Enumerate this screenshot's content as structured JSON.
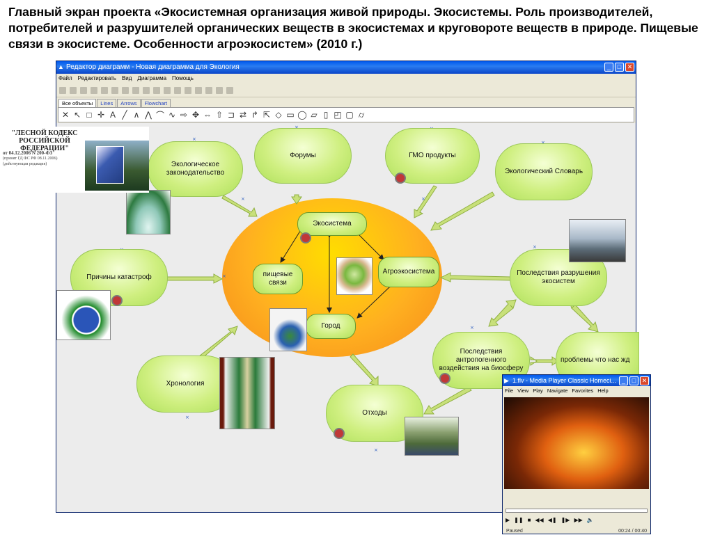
{
  "slide": {
    "title": "Главный экран проекта «Экосистемная организация живой природы. Экосистемы. Роль производителей, потребителей и разрушителей органических веществ в экосистемах и круговороте веществ в природе. Пищевые связи в экосистеме. Особенности агроэкосистем» (2010 г.)"
  },
  "editor": {
    "title": "Редактор диаграмм - Новая диаграмма для Экология",
    "menu": [
      "Файл",
      "Редактировать",
      "Вид",
      "Диаграмма",
      "Помощь"
    ],
    "tabs": [
      "Все объекты",
      "Lines",
      "Arrows",
      "Flowchart"
    ],
    "nodes": {
      "law": "Экологическое законодательство",
      "forums": "Форумы",
      "gmo": "ГМО продукты",
      "dictionary": "Экологический Словарь",
      "disasters": "Причины катастроф",
      "destruction": "Последствия разрушения экосистем",
      "anthropogenic": "Последствия антропогенного воздействия на биосферу",
      "problems": "проблемы что нас жд",
      "chronology": "Хронология",
      "waste": "Отходы",
      "ecosystem": "Экосистема",
      "food_chains": "пищевые связи",
      "agroecosystem": "Агроэкосистема",
      "city": "Город"
    }
  },
  "law_image": {
    "title": "\"ЛЕСНОЙ КОДЕКС РОССИЙСКОЙ ФЕДЕРАЦИИ\"",
    "subtitle": "от 04.12.2006 N 200-ФЗ",
    "note": "(принят ГД ФС РФ 08.11.2006) (действующая редакция)"
  },
  "media_player": {
    "title": "1.flv - Media Player Classic Homeci...",
    "menu": [
      "File",
      "View",
      "Play",
      "Navigate",
      "Favorites",
      "Help"
    ],
    "status_left": "Paused",
    "status_right": "00:24 / 00:40"
  },
  "colors": {
    "node_fill": "#cfef80",
    "center_fill": "#ffb020",
    "arrow_fill": "#c8e07a",
    "marker": "#c03838"
  }
}
